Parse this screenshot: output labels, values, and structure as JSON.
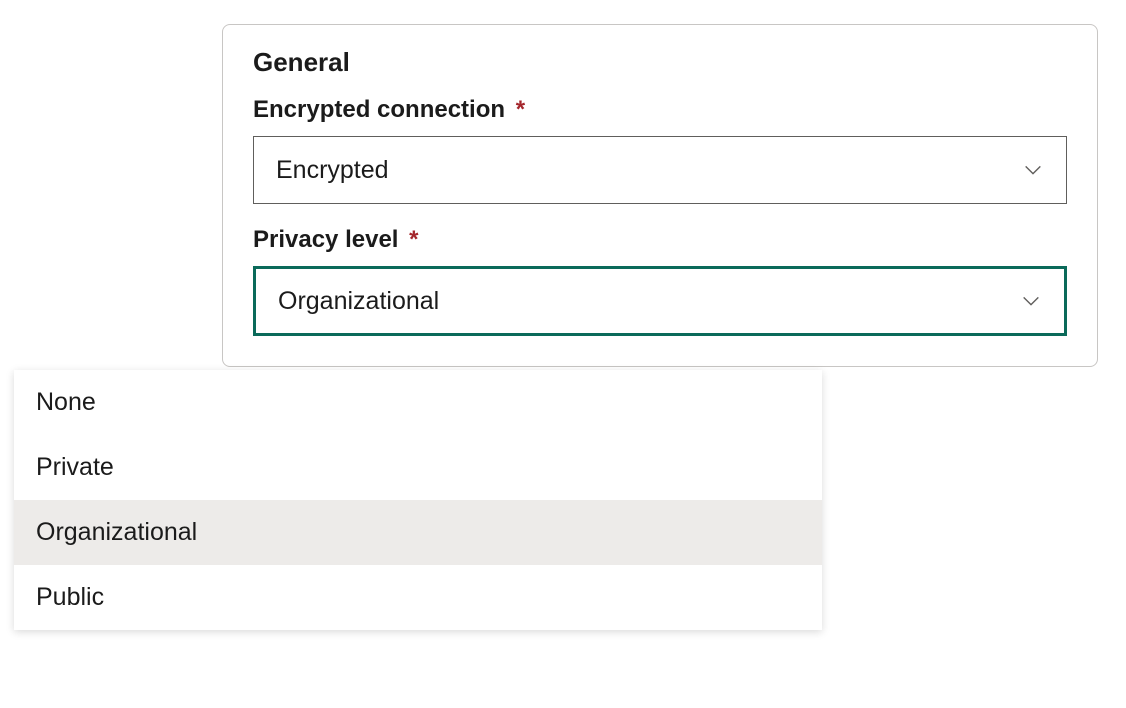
{
  "general": {
    "section_title": "General",
    "encrypted_connection": {
      "label": "Encrypted connection",
      "required_mark": "*",
      "value": "Encrypted"
    },
    "privacy_level": {
      "label": "Privacy level",
      "required_mark": "*",
      "value": "Organizational",
      "options": [
        "None",
        "Private",
        "Organizational",
        "Public"
      ]
    }
  },
  "colors": {
    "active_border": "#0b6a5a",
    "required": "#a4262c"
  }
}
